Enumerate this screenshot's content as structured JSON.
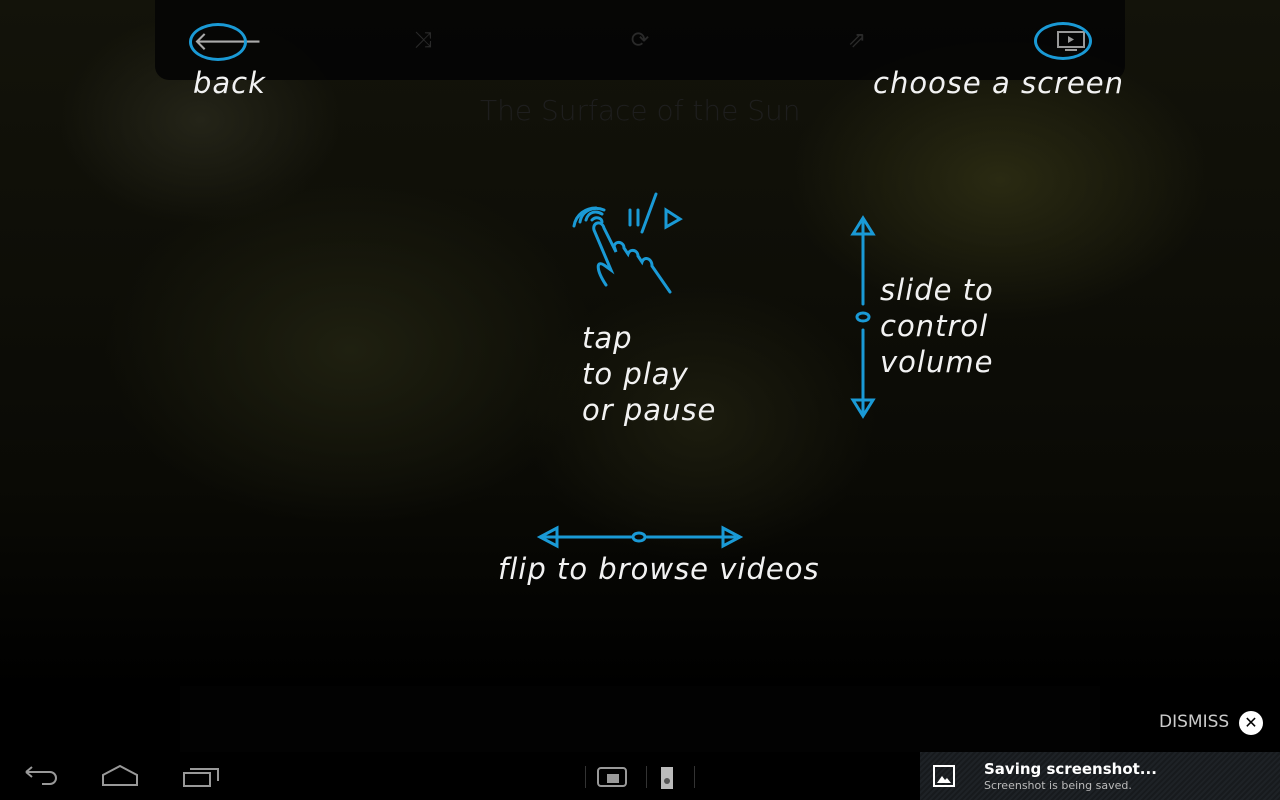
{
  "video": {
    "title": "The Surface of the Sun"
  },
  "toolbar": {
    "back_icon": "arrow-left-icon",
    "shuffle_icon": "shuffle-icon",
    "repeat_icon": "repeat-icon",
    "share_icon": "share-icon",
    "screen_icon": "tv-screen-icon"
  },
  "tutorial": {
    "back": "back",
    "choose_screen": "choose a screen",
    "tap": [
      "tap",
      "to play",
      "or pause"
    ],
    "volume": [
      "slide to",
      "control",
      "volume"
    ],
    "flip": "flip to browse videos",
    "accent": "#1a9ad6"
  },
  "overlay": {
    "dismiss": "DISMISS"
  },
  "notification": {
    "title": "Saving screenshot...",
    "text": "Screenshot is being saved."
  },
  "navbar": {
    "back_icon": "back-icon",
    "home_icon": "home-icon",
    "recents_icon": "recent-apps-icon"
  }
}
